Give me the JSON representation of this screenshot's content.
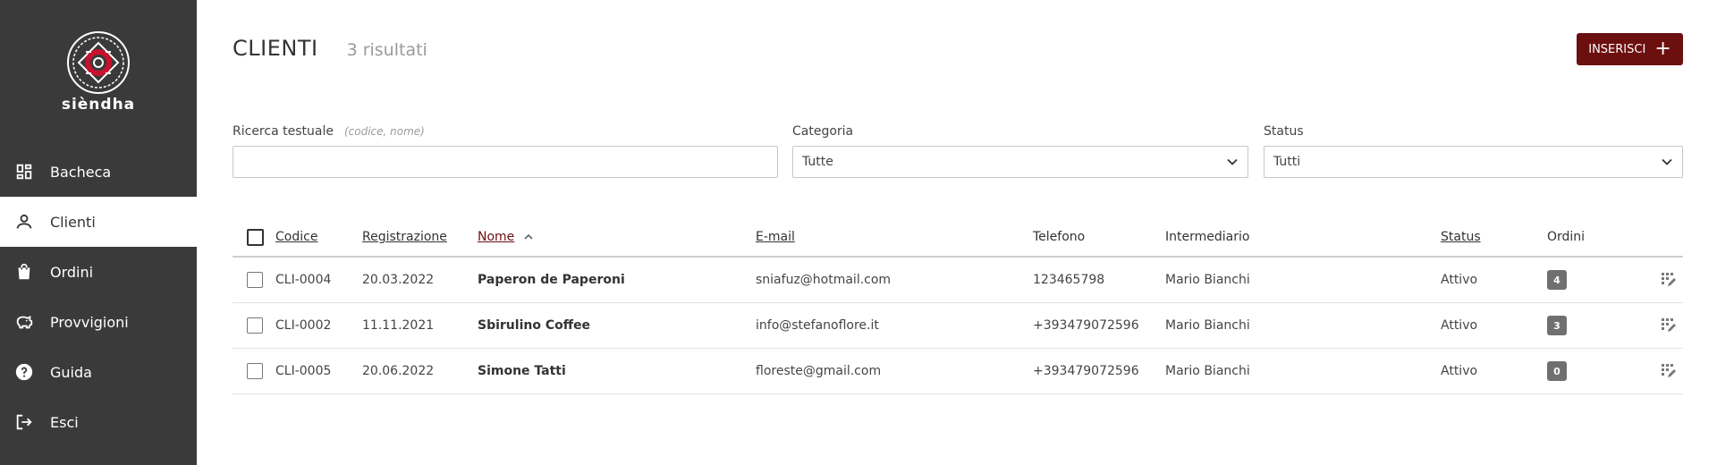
{
  "brand": {
    "name": "siendha_logo_text",
    "text": "sièndha",
    "accent": "#6b0f0f",
    "logo_red": "#c8102e"
  },
  "sidebar": {
    "items": [
      {
        "label": "Bacheca",
        "icon": "dashboard-icon"
      },
      {
        "label": "Clienti",
        "icon": "person-icon",
        "active": true
      },
      {
        "label": "Ordini",
        "icon": "shopping-bag-icon"
      },
      {
        "label": "Provvigioni",
        "icon": "piggy-bank-icon"
      },
      {
        "label": "Guida",
        "icon": "help-icon"
      },
      {
        "label": "Esci",
        "icon": "logout-icon"
      }
    ]
  },
  "header": {
    "title": "CLIENTI",
    "results": "3 risultati",
    "insert_label": "INSERISCI"
  },
  "filters": {
    "search": {
      "label": "Ricerca testuale",
      "hint": "(codice, nome)",
      "value": ""
    },
    "category": {
      "label": "Categoria",
      "value": "Tutte"
    },
    "status": {
      "label": "Status",
      "value": "Tutti"
    }
  },
  "table": {
    "columns": {
      "code": "Codice",
      "registration": "Registrazione",
      "name": "Nome",
      "email": "E-mail",
      "phone": "Telefono",
      "intermediary": "Intermediario",
      "status": "Status",
      "orders": "Ordini"
    },
    "rows": [
      {
        "code": "CLI-0004",
        "registration": "20.03.2022",
        "name": "Paperon de Paperoni",
        "email": "sniafuz@hotmail.com",
        "phone": "123465798",
        "intermediary": "Mario Bianchi",
        "status": "Attivo",
        "orders": "4"
      },
      {
        "code": "CLI-0002",
        "registration": "11.11.2021",
        "name": "Sbirulino Coffee",
        "email": "info@stefanoflore.it",
        "phone": "+393479072596",
        "intermediary": "Mario Bianchi",
        "status": "Attivo",
        "orders": "3"
      },
      {
        "code": "CLI-0005",
        "registration": "20.06.2022",
        "name": "Simone Tatti",
        "email": "floreste@gmail.com",
        "phone": "+393479072596",
        "intermediary": "Mario Bianchi",
        "status": "Attivo",
        "orders": "0"
      }
    ]
  }
}
